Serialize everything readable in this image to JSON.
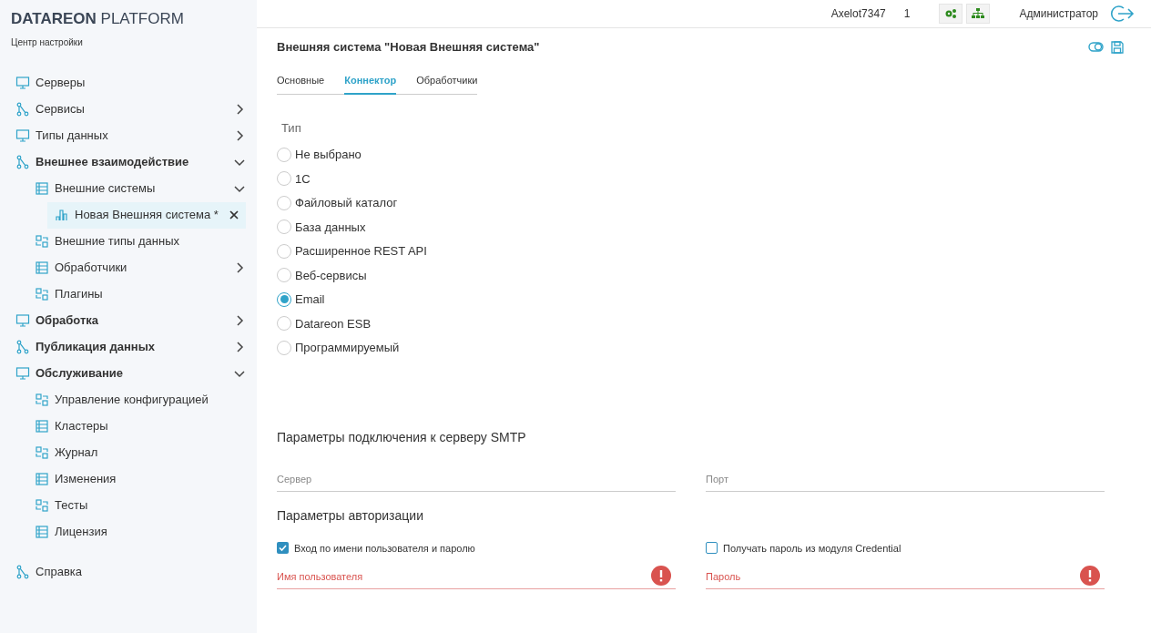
{
  "brand": {
    "name_bold": "DATAREON",
    "name_light": "PLATFORM",
    "subtitle": "Центр настройки"
  },
  "sidebar": {
    "items": [
      {
        "label": "Серверы",
        "bold": false,
        "selected": false
      },
      {
        "label": "Сервисы",
        "bold": false,
        "selected": false,
        "expanded": false
      },
      {
        "label": "Типы данных",
        "bold": false,
        "selected": false,
        "expanded": false
      },
      {
        "label": "Внешнее взаимодействие",
        "bold": true,
        "selected": false,
        "expanded": true,
        "children": [
          {
            "label": "Внешние системы",
            "bold": false,
            "selected": false,
            "expanded": true,
            "children": [
              {
                "label": "Новая Внешняя система *",
                "bold": false,
                "selected": true,
                "closable": true
              }
            ]
          },
          {
            "label": "Внешние типы данных",
            "bold": false,
            "selected": false
          },
          {
            "label": "Обработчики",
            "bold": false,
            "selected": false,
            "expanded": false
          },
          {
            "label": "Плагины",
            "bold": false,
            "selected": false
          }
        ]
      },
      {
        "label": "Обработка",
        "bold": true,
        "selected": false,
        "expanded": false
      },
      {
        "label": "Публикация данных",
        "bold": true,
        "selected": false,
        "expanded": false
      },
      {
        "label": "Обслуживание",
        "bold": true,
        "selected": false,
        "expanded": true,
        "children": [
          {
            "label": "Управление конфигурацией",
            "bold": false,
            "selected": false
          },
          {
            "label": "Кластеры",
            "bold": false,
            "selected": false
          },
          {
            "label": "Журнал",
            "bold": false,
            "selected": false
          },
          {
            "label": "Изменения",
            "bold": false,
            "selected": false
          },
          {
            "label": "Тесты",
            "bold": false,
            "selected": false
          },
          {
            "label": "Лицензия",
            "bold": false,
            "selected": false
          }
        ]
      },
      {
        "label": "Справка",
        "bold": false,
        "selected": false
      }
    ]
  },
  "topbar": {
    "user_code": "Axelot7347",
    "count": "1",
    "role": "Администратор"
  },
  "page": {
    "title": "Внешняя система \"Новая Внешняя система\"",
    "tabs": [
      {
        "label": "Основные",
        "selected": false
      },
      {
        "label": "Коннектор",
        "selected": true
      },
      {
        "label": "Обработчики",
        "selected": false
      }
    ],
    "type_label": "Тип",
    "types": [
      {
        "label": "Не выбрано",
        "selected": false
      },
      {
        "label": "1С",
        "selected": false
      },
      {
        "label": "Файловый каталог",
        "selected": false
      },
      {
        "label": "База данных",
        "selected": false
      },
      {
        "label": "Расширенное REST API",
        "selected": false
      },
      {
        "label": "Веб-сервисы",
        "selected": false
      },
      {
        "label": "Email",
        "selected": true
      },
      {
        "label": "Datareon ESB",
        "selected": false
      },
      {
        "label": "Программируемый",
        "selected": false
      }
    ],
    "smtp_heading": "Параметры подключения к серверу SMTP",
    "smtp_fields": [
      {
        "placeholder": "Сервер",
        "error": false
      },
      {
        "placeholder": "Порт",
        "error": false
      }
    ],
    "auth_heading": "Параметры авторизации",
    "auth_options": [
      {
        "label": "Вход по имени пользователя и паролю",
        "checked": true
      },
      {
        "label": "Получать пароль из модуля Credential",
        "checked": false
      }
    ],
    "auth_fields": [
      {
        "placeholder": "Имя пользователя",
        "error": true
      },
      {
        "placeholder": "Пароль",
        "error": true
      }
    ]
  }
}
